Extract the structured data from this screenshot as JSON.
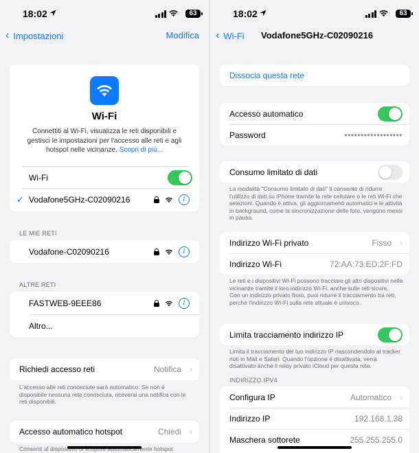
{
  "status": {
    "time": "18:02",
    "battery": "63"
  },
  "left": {
    "nav": {
      "back_label": "Impostazioni",
      "action_label": "Modifica"
    },
    "hero": {
      "title": "Wi-Fi",
      "description": "Connettiti al Wi-Fi, visualizza le reti disponibili e gestisci le impostazioni per l'accesso alle reti e agli hotspot nelle vicinanze.",
      "link": "Scopri di più..."
    },
    "wifi_row_label": "Wi-Fi",
    "wifi_enabled": true,
    "connected_network": "Vodafone5GHz-C02090216",
    "my_networks_header": "LE MIE RETI",
    "my_networks": [
      "Vodafone-C02090216"
    ],
    "other_networks_header": "ALTRE RETI",
    "other_networks": [
      "FASTWEB-9EEE86"
    ],
    "other_label": "Altro...",
    "ask_join": {
      "label": "Richiedi accesso reti",
      "value": "Notifica"
    },
    "ask_join_note": "L'accesso alle reti conosciute sarà automatico. Se non è disponibile nessuna rete conosciuta, riceverai una notifica con le reti disponibili.",
    "hotspot": {
      "label": "Accesso automatico hotspot",
      "value": "Chiedi"
    },
    "hotspot_note": "Consenti al dispositivo di scoprire automaticamente hotspot"
  },
  "right": {
    "nav": {
      "back_label": "Wi-Fi",
      "title": "Vodafone5GHz-C02090216"
    },
    "forget": "Dissocia questa rete",
    "auto_join": {
      "label": "Accesso automatico",
      "enabled": true
    },
    "password": {
      "label": "Password",
      "value": "••••••••••••••••••"
    },
    "low_data": {
      "label": "Consumo limitato di dati",
      "enabled": false
    },
    "low_data_note": "La modalità \"Consumo limitato di dati\" ti consente di ridurre l'utilizzo di dati su iPhone tramite la rete cellulare o le reti Wi-Fi che selezioni. Quando è attiva, gli aggiornamenti automatici e le attività in background, come la sincronizzazione delle foto, vengono messi in pausa.",
    "private_address": {
      "label": "Indirizzo Wi-Fi privato",
      "value": "Fisso"
    },
    "wifi_address": {
      "label": "Indirizzo Wi-Fi",
      "value": "72:AA:73:ED:2F:FD"
    },
    "private_note": "Le reti e i dispositivi Wi-Fi possono tracciare gli altri dispositivi nelle vicinanze tramite il loro indirizzo Wi-Fi, anche sulle reti sicure.\nCon un indirizzo privato fisso, puoi ridurre il tracciamento tra reti, perché l'indirizzo Wi-Fi sulla rete attuale è univoco.",
    "limit_tracking": {
      "label": "Limita tracciamento indirizzo IP",
      "enabled": true
    },
    "limit_note": "Limita il tracciamento del tuo indirizzo IP nascondendolo ai tracker noti in Mail e Safari. Quando l'opzione è disattivata, verrà disattivato anche il relay privato iCloud per questa rete.",
    "ipv4_header": "INDIRIZZO IPV4",
    "configure_ip": {
      "label": "Configura IP",
      "value": "Automatico"
    },
    "ip_address": {
      "label": "Indirizzo IP",
      "value": "192.168.1.38"
    },
    "subnet": {
      "label": "Maschera sottorete",
      "value": "255.255.255.0"
    }
  },
  "colors": {
    "accent": "#0a7aff",
    "toggle_on": "#34c759",
    "background": "#f2f2f7"
  }
}
